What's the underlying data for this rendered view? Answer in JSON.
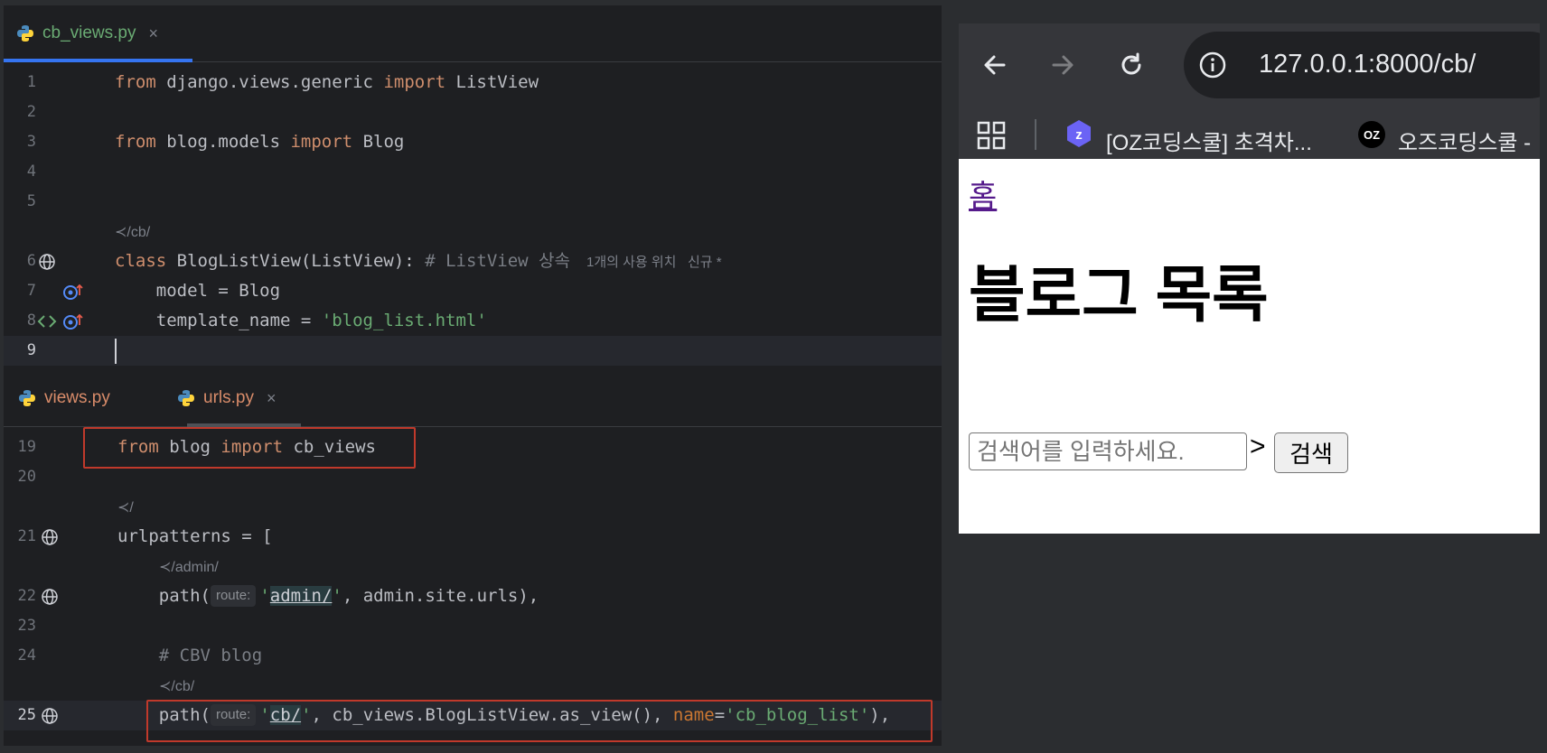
{
  "ide": {
    "top_tab": {
      "filename": "cb_views.py",
      "close": "×"
    },
    "top_lines": [
      {
        "num": "1",
        "tokens": [
          [
            "kw",
            "from"
          ],
          [
            "",
            " django.views.generic "
          ],
          [
            "kw",
            "import"
          ],
          [
            "",
            " ListView"
          ]
        ]
      },
      {
        "num": "2",
        "tokens": []
      },
      {
        "num": "3",
        "tokens": [
          [
            "kw",
            "from"
          ],
          [
            "",
            " blog.models "
          ],
          [
            "kw",
            "import"
          ],
          [
            "",
            " Blog"
          ]
        ]
      },
      {
        "num": "4",
        "tokens": []
      },
      {
        "num": "5",
        "tokens": []
      },
      {
        "num": "",
        "meta": "≺/cb/"
      },
      {
        "num": "6",
        "tokens": [
          [
            "kw",
            "class"
          ],
          [
            "",
            " BlogListView(ListView): "
          ],
          [
            "cmt",
            "# ListView 상속"
          ]
        ],
        "usage": "1개의 사용 위치   신규 *"
      },
      {
        "num": "7",
        "tokens": [
          [
            "",
            "    model = Blog"
          ]
        ]
      },
      {
        "num": "8",
        "tokens": [
          [
            "",
            "    template_name = "
          ],
          [
            "str",
            "'blog_list.html'"
          ]
        ]
      },
      {
        "num": "9",
        "tokens": []
      }
    ],
    "bottom_tabs": [
      {
        "filename": "views.py"
      },
      {
        "filename": "urls.py",
        "close": "×"
      }
    ],
    "bottom_lines": [
      {
        "num": "19",
        "tokens": [
          [
            "kw",
            "from"
          ],
          [
            "",
            " blog "
          ],
          [
            "kw",
            "import"
          ],
          [
            "",
            " cb_views"
          ]
        ]
      },
      {
        "num": "20",
        "tokens": []
      },
      {
        "num": "",
        "meta": "≺/"
      },
      {
        "num": "21",
        "tokens": [
          [
            "",
            "urlpatterns = ["
          ]
        ]
      },
      {
        "num": "",
        "meta": "≺/admin/"
      },
      {
        "num": "22",
        "tokens": [
          [
            "",
            "    path("
          ],
          [
            "hint",
            "route:"
          ],
          [
            "str",
            "'"
          ],
          [
            "u",
            "admin/"
          ],
          [
            "str",
            "'"
          ],
          [
            "",
            ", admin.site.urls),"
          ]
        ]
      },
      {
        "num": "23",
        "tokens": []
      },
      {
        "num": "24",
        "tokens": [
          [
            "cmt",
            "    # CBV blog"
          ]
        ]
      },
      {
        "num": "",
        "meta": "≺/cb/"
      },
      {
        "num": "25",
        "tokens": [
          [
            "",
            "    path("
          ],
          [
            "hint",
            "route:"
          ],
          [
            "str",
            "'"
          ],
          [
            "u",
            "cb/"
          ],
          [
            "str",
            "'"
          ],
          [
            "",
            ", cb_views.BlogListView.as_view(), "
          ],
          [
            "param",
            "name"
          ],
          [
            "",
            "="
          ],
          [
            "str",
            "'cb_blog_list'"
          ],
          [
            "",
            "),"
          ]
        ]
      }
    ]
  },
  "browser": {
    "url": "127.0.0.1:8000/cb/",
    "bookmarks": [
      {
        "label": "[OZ코딩스쿨] 초격차...",
        "icon": "z-hex-icon"
      },
      {
        "label": "오즈코딩스쿨 -",
        "icon": "oz-circle-icon"
      }
    ],
    "page": {
      "home_link": "홈",
      "title": "블로그 목록",
      "search_placeholder": "검색어를 입력하세요.",
      "gt": ">",
      "search_button": "검색"
    }
  },
  "colors": {
    "ide_bg": "#1e1f22",
    "keyword": "#cf8e6d",
    "string": "#6aab73",
    "comment": "#7a7e85",
    "highlight_box": "#c0392b",
    "tab_accent": "#3574f0"
  }
}
